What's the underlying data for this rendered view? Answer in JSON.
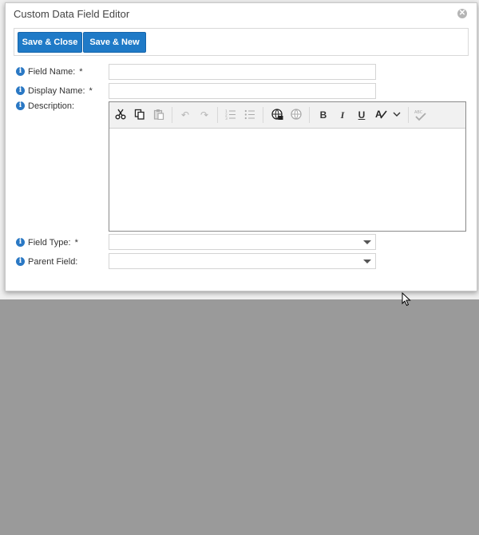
{
  "dialog": {
    "title": "Custom Data Field Editor",
    "close_icon": "close-icon"
  },
  "toolbar": {
    "save_close_label": "Save & Close",
    "save_new_label": "Save & New"
  },
  "fields": {
    "field_name": {
      "label": "Field Name:",
      "required": "*",
      "value": ""
    },
    "display_name": {
      "label": "Display Name:",
      "required": "*",
      "value": ""
    },
    "description": {
      "label": "Description:"
    },
    "field_type": {
      "label": "Field Type:",
      "required": "*",
      "value": ""
    },
    "parent_field": {
      "label": "Parent Field:",
      "value": ""
    }
  },
  "editor_toolbar": {
    "icons": [
      "cut-icon",
      "copy-icon",
      "paste-icon",
      "undo-icon",
      "redo-icon",
      "numbered-list-icon",
      "bulleted-list-icon",
      "insert-link-icon",
      "remove-link-icon",
      "bold-icon",
      "italic-icon",
      "underline-icon",
      "font-color-icon",
      "dropdown-icon",
      "spellcheck-icon"
    ],
    "bold_glyph": "B",
    "italic_glyph": "I",
    "underline_glyph": "U",
    "spellcheck_text": "ABC"
  },
  "colors": {
    "primary_button": "#1f7ac7",
    "info_icon": "#2a78c4",
    "overlay": "#9a9a9a"
  }
}
